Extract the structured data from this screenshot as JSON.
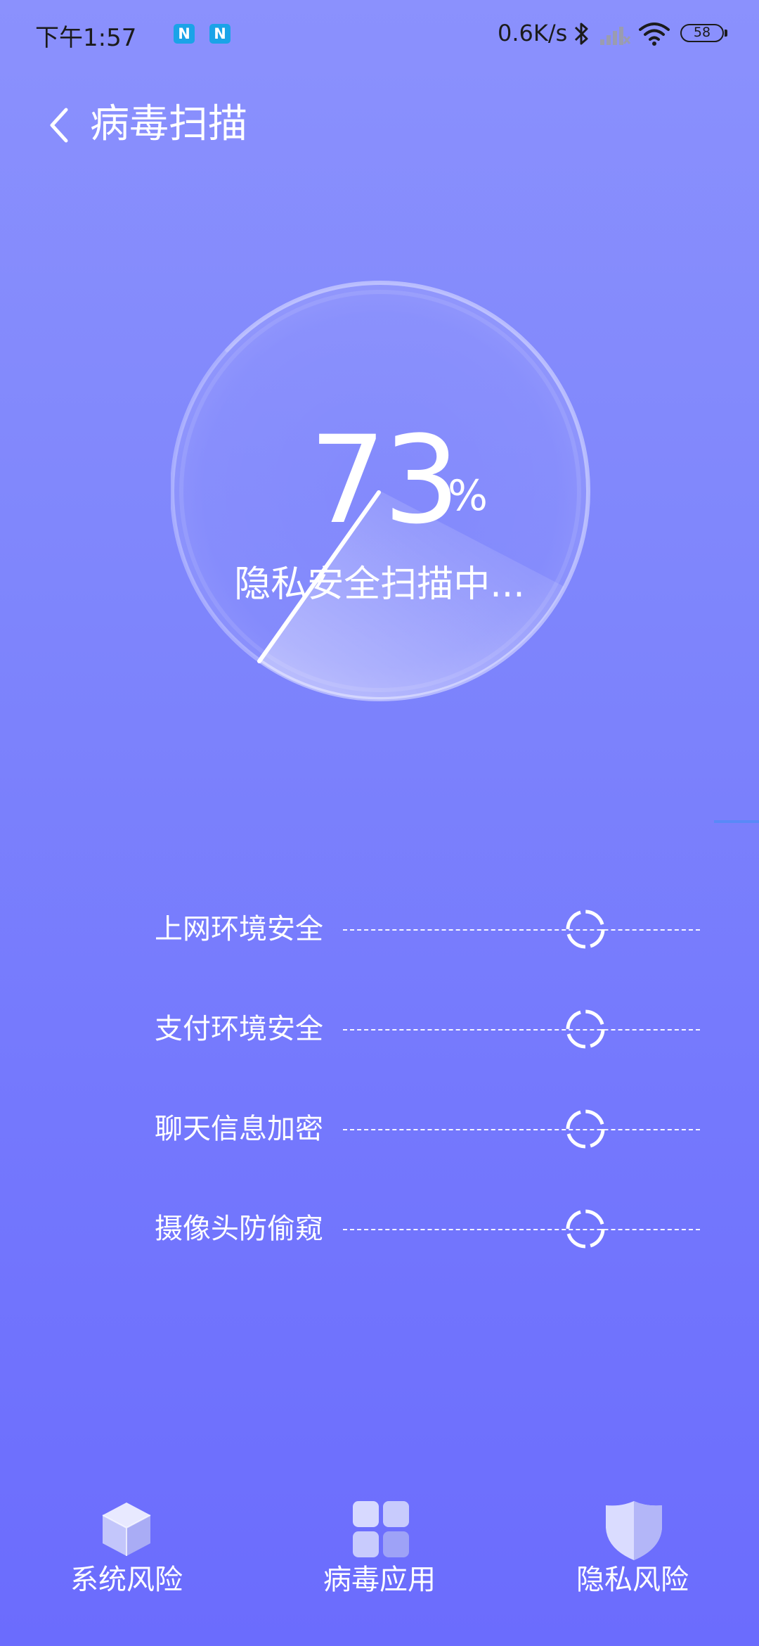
{
  "status_bar": {
    "time": "下午1:57",
    "net_speed": "0.6K/s",
    "battery": "58",
    "notification_icons": [
      "N",
      "N"
    ]
  },
  "header": {
    "title": "病毒扫描"
  },
  "scan": {
    "percent": "73",
    "percent_sign": "%",
    "status": "隐私安全扫描中...",
    "progress_fraction": 0.73
  },
  "checks": [
    {
      "label": "上网环境安全"
    },
    {
      "label": "支付环境安全"
    },
    {
      "label": "聊天信息加密"
    },
    {
      "label": "摄像头防偷窥"
    }
  ],
  "bottom_nav": [
    {
      "label": "系统风险",
      "icon": "cube-icon"
    },
    {
      "label": "病毒应用",
      "icon": "app-grid-icon"
    },
    {
      "label": "隐私风险",
      "icon": "shield-icon"
    }
  ],
  "colors": {
    "background_top": "#8b91fd",
    "background_bottom": "#6b6cfd",
    "text": "#ffffff"
  }
}
